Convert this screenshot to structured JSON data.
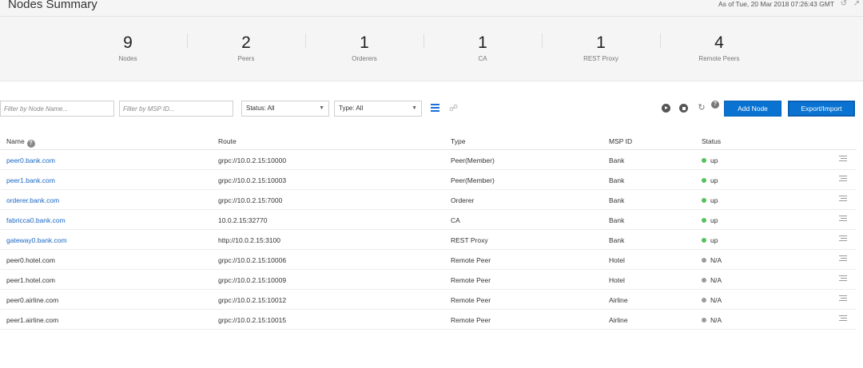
{
  "header": {
    "title": "Nodes Summary",
    "as_of": "As of Tue, 20 Mar 2018 07:26:43 GMT"
  },
  "stats": [
    {
      "value": "9",
      "label": "Nodes"
    },
    {
      "value": "2",
      "label": "Peers"
    },
    {
      "value": "1",
      "label": "Orderers"
    },
    {
      "value": "1",
      "label": "CA"
    },
    {
      "value": "1",
      "label": "REST Proxy"
    },
    {
      "value": "4",
      "label": "Remote Peers"
    }
  ],
  "toolbar": {
    "filter_name_placeholder": "Filter by Node Name...",
    "filter_msp_placeholder": "Filter by MSP ID...",
    "status_select": "Status: All",
    "type_select": "Type: All",
    "add_node": "Add Node",
    "export_import": "Export/Import"
  },
  "table": {
    "columns": {
      "name": "Name",
      "route": "Route",
      "type": "Type",
      "msp_id": "MSP ID",
      "status": "Status"
    },
    "rows": [
      {
        "name": "peer0.bank.com",
        "route": "grpc://10.0.2.15:10000",
        "type": "Peer(Member)",
        "msp": "Bank",
        "status": "up"
      },
      {
        "name": "peer1.bank.com",
        "route": "grpc://10.0.2.15:10003",
        "type": "Peer(Member)",
        "msp": "Bank",
        "status": "up"
      },
      {
        "name": "orderer.bank.com",
        "route": "grpc://10.0.2.15:7000",
        "type": "Orderer",
        "msp": "Bank",
        "status": "up"
      },
      {
        "name": "fabricca0.bank.com",
        "route": "10.0.2.15:32770",
        "type": "CA",
        "msp": "Bank",
        "status": "up"
      },
      {
        "name": "gateway0.bank.com",
        "route": "http://10.0.2.15:3100",
        "type": "REST Proxy",
        "msp": "Bank",
        "status": "up"
      },
      {
        "name": "peer0.hotel.com",
        "route": "grpc://10.0.2.15:10006",
        "type": "Remote Peer",
        "msp": "Hotel",
        "status": "N/A"
      },
      {
        "name": "peer1.hotel.com",
        "route": "grpc://10.0.2.15:10009",
        "type": "Remote Peer",
        "msp": "Hotel",
        "status": "N/A"
      },
      {
        "name": "peer0.airline.com",
        "route": "grpc://10.0.2.15:10012",
        "type": "Remote Peer",
        "msp": "Airline",
        "status": "N/A"
      },
      {
        "name": "peer1.airline.com",
        "route": "grpc://10.0.2.15:10015",
        "type": "Remote Peer",
        "msp": "Airline",
        "status": "N/A"
      }
    ]
  },
  "colors": {
    "accent": "#0a73d1",
    "link": "#1a67c4",
    "status_up": "#55c15b",
    "status_na": "#9a9a9a"
  }
}
